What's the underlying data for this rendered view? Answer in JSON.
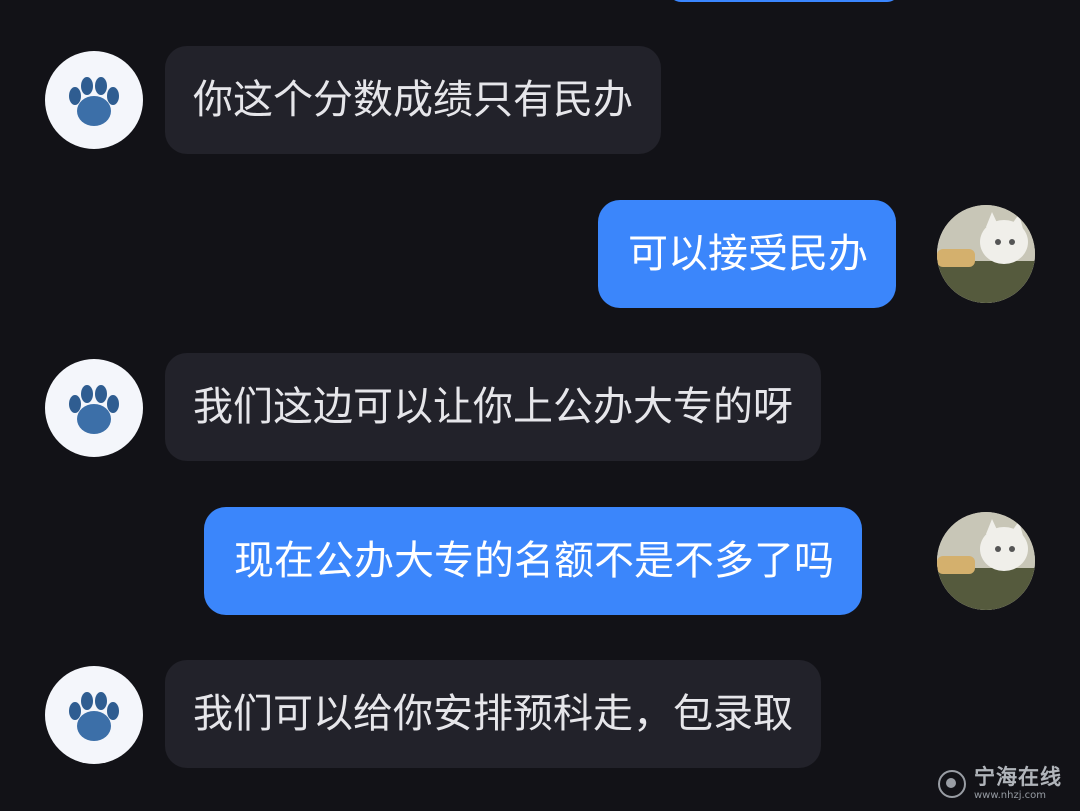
{
  "chat": {
    "messages": [
      {
        "direction": "received",
        "text": "你这个分数成绩只有民办"
      },
      {
        "direction": "sent",
        "text": "可以接受民办"
      },
      {
        "direction": "received",
        "text": "我们这边可以让你上公办大专的呀"
      },
      {
        "direction": "sent",
        "text": "现在公办大专的名额不是不多了吗"
      },
      {
        "direction": "received",
        "text": "我们可以给你安排预科走，包录取"
      }
    ],
    "avatars": {
      "received": "paw-print-icon",
      "sent": "cat-photo-avatar"
    }
  },
  "watermark": {
    "title": "宁海在线",
    "url": "www.nhzj.com",
    "icon": "swirl-logo-icon"
  },
  "colors": {
    "background": "#121217",
    "received_bubble": "#22222a",
    "sent_bubble": "#3b86fb",
    "received_text": "#e6e6ea",
    "sent_text": "#ffffff"
  }
}
